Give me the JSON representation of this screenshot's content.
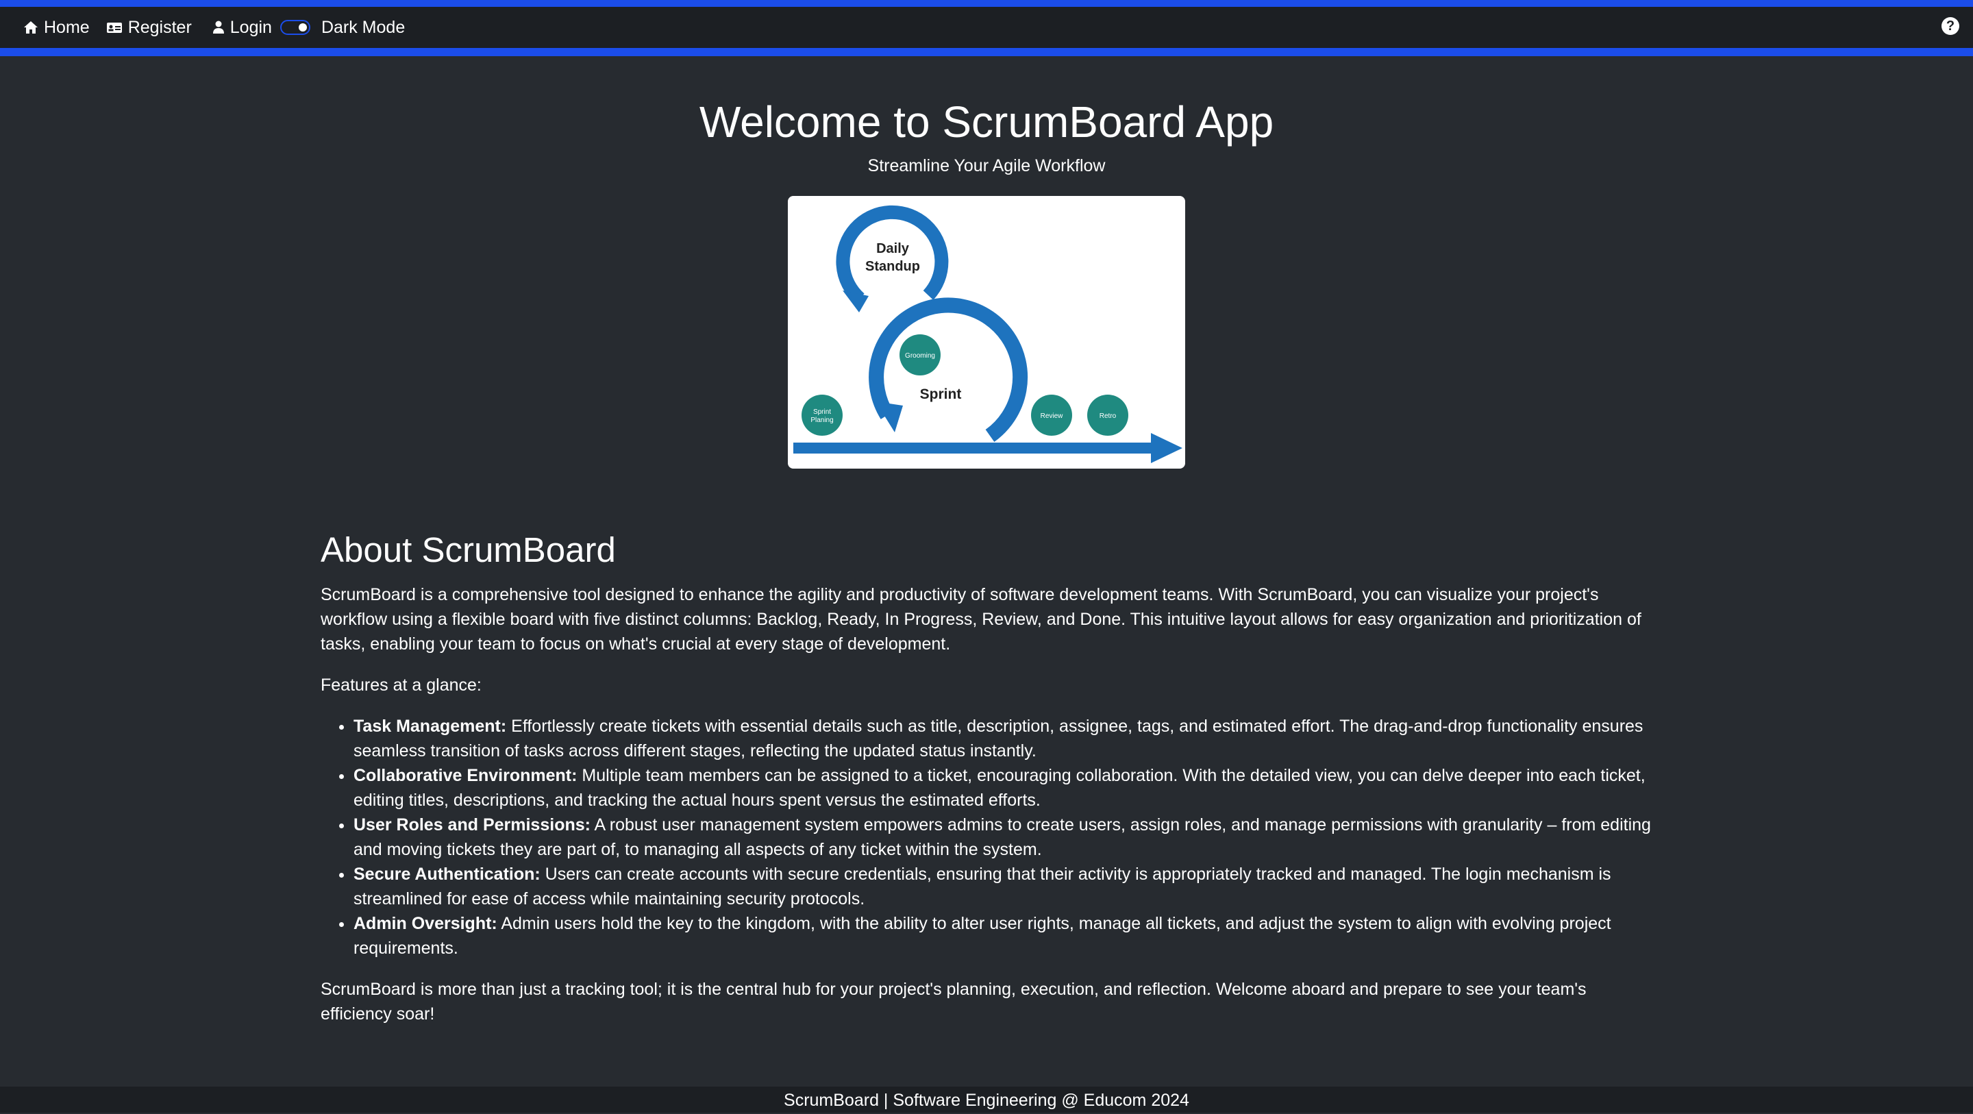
{
  "navbar": {
    "home_label": "Home",
    "register_label": "Register",
    "login_label": "Login",
    "dark_mode_label": "Dark Mode",
    "dark_mode_on": true,
    "help_symbol": "?"
  },
  "hero": {
    "title": "Welcome to ScrumBoard App",
    "subtitle": "Streamline Your Agile Workflow",
    "diagram": {
      "daily_standup_line1": "Daily",
      "daily_standup_line2": "Standup",
      "sprint": "Sprint",
      "grooming": "Grooming",
      "sprint_planning_line1": "Sprint",
      "sprint_planning_line2": "Planing",
      "review": "Review",
      "retro": "Retro"
    }
  },
  "about": {
    "title": "About ScrumBoard",
    "intro": "ScrumBoard is a comprehensive tool designed to enhance the agility and productivity of software development teams. With ScrumBoard, you can visualize your project's workflow using a flexible board with five distinct columns: Backlog, Ready, In Progress, Review, and Done. This intuitive layout allows for easy organization and prioritization of tasks, enabling your team to focus on what's crucial at every stage of development.",
    "features_heading": "Features at a glance:",
    "features": [
      {
        "title": "Task Management:",
        "text": "Effortlessly create tickets with essential details such as title, description, assignee, tags, and estimated effort. The drag-and-drop functionality ensures seamless transition of tasks across different stages, reflecting the updated status instantly."
      },
      {
        "title": "Collaborative Environment:",
        "text": "Multiple team members can be assigned to a ticket, encouraging collaboration. With the detailed view, you can delve deeper into each ticket, editing titles, descriptions, and tracking the actual hours spent versus the estimated efforts."
      },
      {
        "title": "User Roles and Permissions:",
        "text": "A robust user management system empowers admins to create users, assign roles, and manage permissions with granularity – from editing and moving tickets they are part of, to managing all aspects of any ticket within the system."
      },
      {
        "title": "Secure Authentication:",
        "text": "Users can create accounts with secure credentials, ensuring that their activity is appropriately tracked and managed. The login mechanism is streamlined for ease of access while maintaining security protocols."
      },
      {
        "title": "Admin Oversight:",
        "text": "Admin users hold the key to the kingdom, with the ability to alter user rights, manage all tickets, and adjust the system to align with evolving project requirements."
      }
    ],
    "closing": "ScrumBoard is more than just a tracking tool; it is the central hub for your project's planning, execution, and reflection. Welcome aboard and prepare to see your team's efficiency soar!"
  },
  "footer": {
    "text": "ScrumBoard | Software Engineering @ Educom 2024"
  },
  "colors": {
    "accent": "#1b4dea",
    "navbar_bg": "#1c1f23",
    "page_bg": "#272b30",
    "diagram_blue": "#1e73be",
    "diagram_teal": "#1f8a80"
  }
}
